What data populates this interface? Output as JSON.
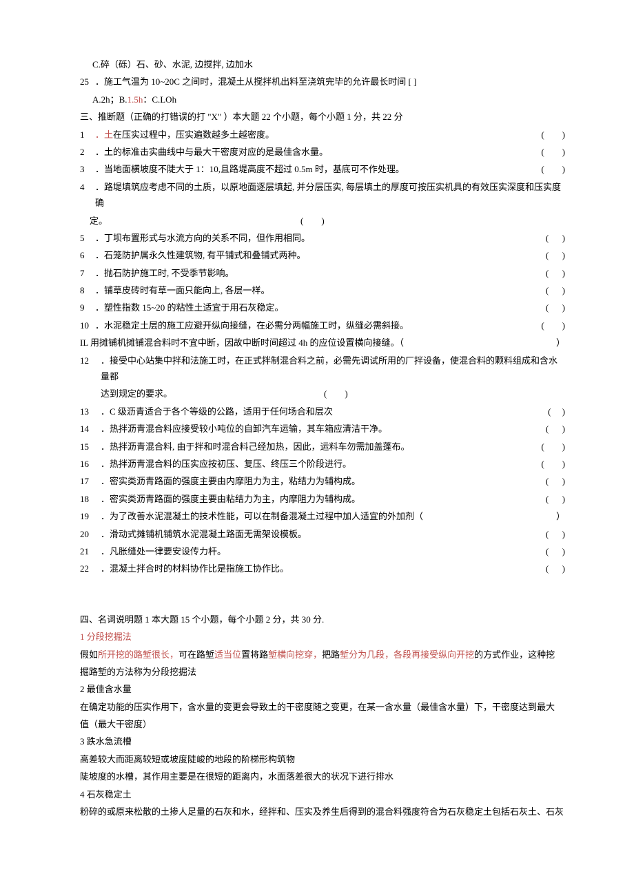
{
  "optC": "C.碎（砾）石、砂、水泥, 边搅拌, 边加水",
  "q25_num": "25",
  "q25_text": "．施工气温为 10~20C 之间时，混凝土从搅拌机出料至浇筑完毕的允许最长时间 [ ]",
  "q25_opts_a": "A.2h；B.",
  "q25_opts_b": "1.5h",
  "q25_opts_c": "：C.LOh",
  "sec3": "三、推断题（正确的打错误的打 \"X\" ）本大题 22 个小题，每个小题 1 分，共 22 分",
  "j1n": "1",
  "j1t": "．土",
  "j1t2": "在压实过程中，压实遍数越多土越密度。",
  "j1p": "(        )",
  "j2n": "2",
  "j2t": "．土的标准击实曲线中与最大干密度对应的是最佳含水量。",
  "j2p": "(        )",
  "j3n": "3",
  "j3t": "．当地面横坡度不陡大于 1：10,且路堤高度不超过 0.5m 时，基底可不作处理。",
  "j3p": "(        )",
  "j4n": "4",
  "j4t": "．路堤填筑应考虑不同的土质，以原地面逐层填起, 并分层压实, 每层填土的厚度可按压实机具的有效压实深度和压实度确",
  "j4t2": "定。",
  "j4p": "(        )",
  "j5n": "5",
  "j5t": "．丁坝布置形式与水流方向的关系不同，但作用相同。",
  "j5p": "(      )",
  "j6n": "6",
  "j6t": "．石笼防护属永久性建筑物, 有平铺式和叠铺式两种。",
  "j6p": "(      )",
  "j7n": "7",
  "j7t": "．抛石防护施工时, 不受季节影响。",
  "j7p": "(      )",
  "j8n": "8",
  "j8t": "．铺草皮砖时有草一面只能向上, 各层一样。",
  "j8p": "(      )",
  "j9n": "9",
  "j9t": "．塑性指数 15~20 的粘性土适宜于用石灰稳定。",
  "j9p": "(      )",
  "j10n": "10",
  "j10t": "．水泥稳定土层的施工应避开纵向接缝，在必需分两幅施工时，纵缝必需斜接。",
  "j10p": "(        )",
  "j11": "IL 用摊铺机摊铺混合料时不宜中断，因故中断时间超过 4h 的应位设置横向接缝。（",
  "j11p": "）",
  "j12n": "12",
  "j12t": "．接受中心站集中拌和法施工时，在正式拌制混合料之前，必需先调试所用的厂拌设备，使混合料的颗料组成和含水量都",
  "j12t2": "达到规定的要求。",
  "j12p": "(        )",
  "j13n": "13",
  "j13t": "．C 级沥青适合于各个等级的公路，适用于任何场合和层次",
  "j13p": "(     )",
  "j14n": "14",
  "j14t": "．热拌沥青混合料应接受较小吨位的自卸汽车运输，其车箱应清洁干净。",
  "j14p": "(      )",
  "j15n": "15",
  "j15t": "．热拌沥青混合料, 由于拌和时混合料己经加热，因此，运料车勿需加盖蓬布。",
  "j15p": "(        )",
  "j16n": "16",
  "j16t": "．热拌沥青混合料的压实应按初压、复压、终压三个阶段进行。",
  "j16p": "(        )",
  "j17n": "17",
  "j17t": "．密实类沥青路面的强度主要由内摩阻力为主，粘结力为辅构成。",
  "j17p": "(      )",
  "j18n": "18",
  "j18t": "．密实类沥青路面的强度主要由粘结力为主，内摩阻力为辅构成。",
  "j18p": "(      )",
  "j19n": "19",
  "j19t": "．为了改善水泥混凝土的技术性能，可以在制备混凝土过程中加人适宜的外加剂（",
  "j19p": "）",
  "j20n": "20",
  "j20t": "．滑动式摊铺机铺筑水泥混凝土路面无需架设模板。",
  "j20p": "(      )",
  "j21n": "21",
  "j21t": "．凡胀缝处一律要安设传力杆。",
  "j21p": "(      )",
  "j22n": "22",
  "j22t": "．混凝土拌合时的材料协作比是指施工协作比。",
  "j22p": "(      )",
  "sec4": "四、名词说明题 1 本大题 15 个小题，每个小题 2 分，共 30 分.",
  "t1": "1 分段挖掘法",
  "t1a": "假如",
  "t1b": "所开挖的路堑很长，",
  "t1c": "可在路堑",
  "t1d": "适当位",
  "t1e": "置将路",
  "t1f": "堑横向挖穿，",
  "t1g": "把路",
  "t1h": "堑分为几段，各段再接受纵向开挖",
  "t1i": "的方式作业，这种挖",
  "t1j": "掘路堑的方法称为分段挖掘法",
  "t2": "2 最佳含水量",
  "t2a": "在确定功能的压实作用下，含水量的变更会导致土的干密度随之变更，在某一含水量（最佳含水量）下，干密度达到最大",
  "t2b": "值（最大干密度）",
  "t3": "3 跌水急流槽",
  "t3a": "高差较大而距离较短或坡度陡峻的地段的阶梯形构筑物",
  "t3b": "陡坡度的水槽，其作用主要是在很短的距离内，水面落差很大的状况下进行排水",
  "t4": "4 石灰稳定土",
  "t4a": "粉碎的或原来松散的土掺人足量的石灰和水，经拌和、压实及养生后得到的混合料强度符合为石灰稳定土包括石灰土、石灰"
}
